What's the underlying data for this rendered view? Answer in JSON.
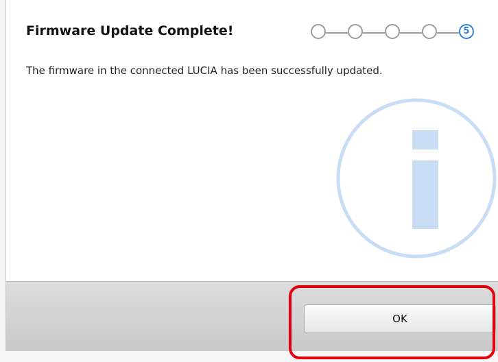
{
  "dialog": {
    "title": "Firmware Update Complete!",
    "message": "The firmware in the connected LUCIA has been successfully updated."
  },
  "progress": {
    "total_steps": 5,
    "current_step": 5,
    "current_step_label": "5"
  },
  "buttons": {
    "ok_label": "OK"
  },
  "colors": {
    "accent": "#2f80d9",
    "watermark": "#c8ddf5",
    "highlight": "#e3000f"
  },
  "icons": {
    "watermark": "info-icon"
  }
}
